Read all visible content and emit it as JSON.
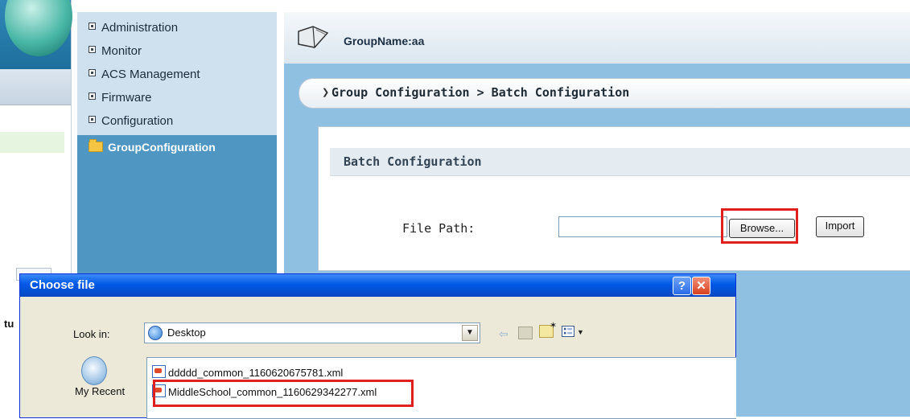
{
  "navigation": {
    "items": [
      {
        "label": "Administration"
      },
      {
        "label": "Monitor"
      },
      {
        "label": "ACS  Management"
      },
      {
        "label": "Firmware"
      },
      {
        "label": "Configuration"
      }
    ],
    "active_item": {
      "label": "GroupConfiguration",
      "icon": "folder-icon"
    }
  },
  "header": {
    "group_name": "GroupName:aa",
    "icon": "group-icon"
  },
  "breadcrumb": {
    "arrow": "❯",
    "text": "Group Configuration > Batch Configuration"
  },
  "batch_panel": {
    "title": "Batch Configuration",
    "file_path_label": "File Path:",
    "file_path_value": "",
    "browse_label": "Browse...",
    "import_label": "Import"
  },
  "dialog": {
    "title": "Choose file",
    "help_label": "?",
    "close_label": "✕",
    "look_in_label": "Look in:",
    "look_in_value": "Desktop",
    "places": [
      {
        "label": "My Recent"
      }
    ],
    "files": [
      {
        "name": "ddddd_common_1160620675781.xml",
        "icon": "xml-file-icon"
      },
      {
        "name": "MiddleSchool_common_1160629342277.xml",
        "icon": "xml-file-icon"
      }
    ]
  },
  "left_fragment": {
    "text": "tu"
  },
  "colors": {
    "nav_bg": "#4f96c3",
    "main_bg": "#8fc0e2",
    "highlight": "#e01f1f",
    "titlebar": "#0058e6"
  }
}
